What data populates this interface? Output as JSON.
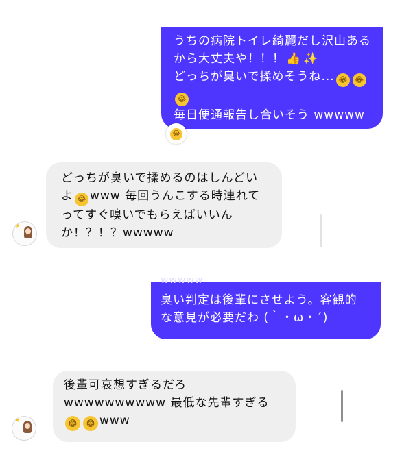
{
  "messages": [
    {
      "id": "msg1",
      "direction": "sent",
      "lines": [
        "うちの病院トイレ綺麗だし沢山ある",
        "から大丈夫や！！！",
        "どっちが臭いで揉めそうね...",
        "",
        "毎日便通報告し合いそう wwwww"
      ],
      "emoji": [
        "thumbs-up",
        "sparkles",
        "rolling-laughing",
        "rolling-laughing",
        "rolling-laughing"
      ],
      "reaction": "face-with-tears-of-joy"
    },
    {
      "id": "msg2",
      "direction": "received",
      "lines": [
        "どっちが臭いで揉めるのはしんどい",
        "www 毎回うんこする時連れて",
        "ってすぐ嗅いでもらえばいいん",
        "か！？！？wwwww"
      ],
      "line2_prefix": "よ",
      "emoji": [
        "rolling-laughing"
      ]
    },
    {
      "id": "msg3",
      "direction": "sent",
      "cut_text": "wwwww",
      "lines": [
        "臭い判定は後輩にさせよう。客観的",
        "な意見が必要だわ (｀・ω・´)"
      ]
    },
    {
      "id": "msg4",
      "direction": "received",
      "lines": [
        "後輩可哀想すぎるだろ",
        "wwwwwwwwww 最低な先輩すぎる",
        "www"
      ],
      "emoji": [
        "face-with-tears-of-joy",
        "face-with-tears-of-joy"
      ]
    }
  ],
  "colors": {
    "sent_bubble": "#4f36ff",
    "received_bubble": "#efefef",
    "sent_text": "#ffffff",
    "received_text": "#111111"
  }
}
